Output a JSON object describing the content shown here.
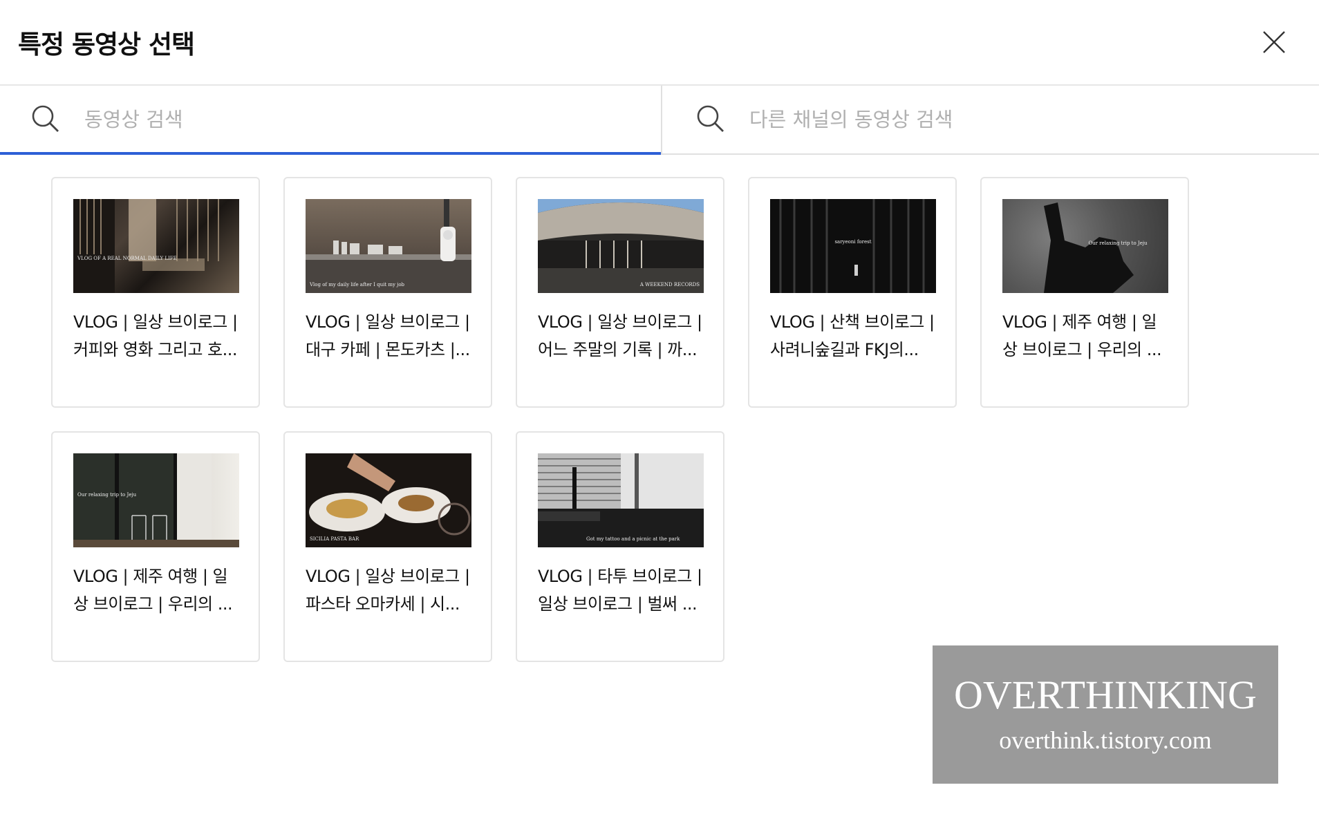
{
  "header": {
    "title": "특정 동영상 선택",
    "close_icon": "close-icon"
  },
  "search": {
    "own": {
      "placeholder": "동영상 검색",
      "value": "",
      "icon": "search-icon"
    },
    "other": {
      "placeholder": "다른 채널의 동영상 검색",
      "value": "",
      "icon": "search-icon"
    },
    "active_color": "#2d5fd6"
  },
  "videos": [
    {
      "title": "VLOG | 일상 브이로그 |\n커피와 영화 그리고 호...",
      "thumb_text": "VLOG OF A REAL NORMAL DAILY LIFE"
    },
    {
      "title": "VLOG | 일상 브이로그 |\n대구 카페 | 몬도카츠 |...",
      "thumb_text": "Vlog of my daily life after I quit my job"
    },
    {
      "title": "VLOG | 일상 브이로그 |\n어느 주말의 기록 | 까...",
      "thumb_text": "A WEEKEND RECORDS"
    },
    {
      "title": "VLOG | 산책 브이로그 |\n사려니숲길과 FKJ의...",
      "thumb_text": "saryeoni forest"
    },
    {
      "title": "VLOG | 제주 여행 | 일\n상 브이로그 | 우리의 ...",
      "thumb_text": "Our relaxing trip to Jeju"
    },
    {
      "title": "VLOG | 제주 여행 | 일\n상 브이로그 | 우리의 ...",
      "thumb_text": "Our relaxing trip to Jeju"
    },
    {
      "title": "VLOG | 일상 브이로그 |\n파스타 오마카세 | 시...",
      "thumb_text": "SICILIA PASTA BAR"
    },
    {
      "title": "VLOG | 타투 브이로그 |\n일상 브이로그 | 벌써 ...",
      "thumb_text": "Got my tattoo and a picnic at the park"
    }
  ],
  "watermark": {
    "title": "OVERTHINKING",
    "url": "overthink.tistory.com"
  }
}
